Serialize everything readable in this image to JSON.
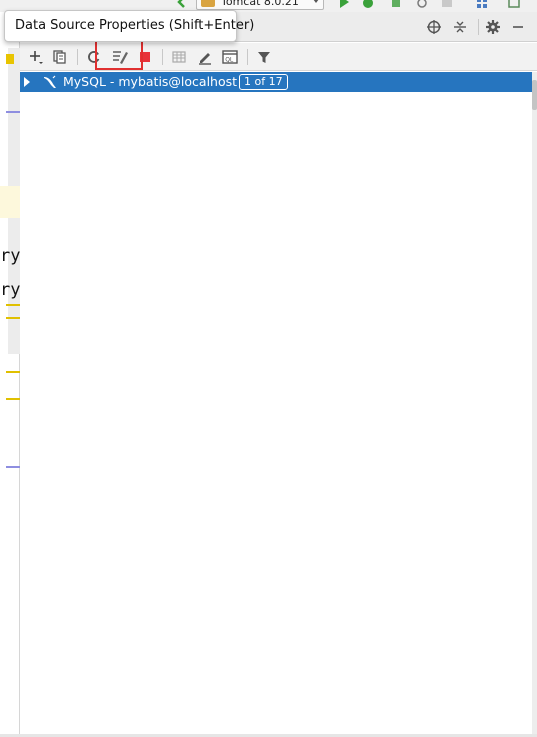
{
  "run_toolbar": {
    "run_config_label": "Tomcat 8.0.21"
  },
  "tooltip": {
    "text": "Data Source Properties (Shift+Enter)"
  },
  "editor_fragment": {
    "line1": "ry",
    "line2": "ry"
  },
  "tree": {
    "rows": [
      {
        "label": "MySQL - mybatis@localhost",
        "badge": "1 of 17",
        "selected": true
      }
    ]
  },
  "icons": {
    "header": [
      "target-icon",
      "collapse-all-icon",
      "gear-icon",
      "minimize-icon"
    ],
    "toolbar": [
      "add-icon",
      "duplicate-icon",
      "refresh-icon",
      "properties-icon",
      "stop-icon",
      "table-icon",
      "edit-icon",
      "console-icon",
      "filter-icon"
    ]
  },
  "colors": {
    "selection": "#2675bf",
    "highlight_box": "#e03030",
    "stop_icon": "#e8333a",
    "run_icon": "#3aa13a"
  }
}
